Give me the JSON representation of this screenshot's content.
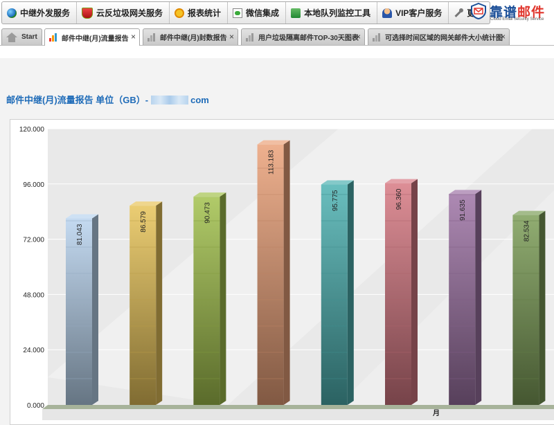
{
  "menu": [
    {
      "label": "中继外发服务",
      "icon": "globe-icon"
    },
    {
      "label": "云反垃圾网关服务",
      "icon": "shield-icon"
    },
    {
      "label": "报表统计",
      "icon": "report-icon"
    },
    {
      "label": "微信集成",
      "icon": "wechat-icon"
    },
    {
      "label": "本地队列监控工具",
      "icon": "queue-icon"
    },
    {
      "label": "VIP客户服务",
      "icon": "vip-user-icon"
    },
    {
      "label": "更多",
      "icon": "wrench-icon"
    }
  ],
  "brand": {
    "name": "靠谱",
    "name_accent": "邮件",
    "tagline": "Cloud Email Security Service"
  },
  "tabs": [
    {
      "label": "Start",
      "icon": "home-icon",
      "active": false,
      "closable": false
    },
    {
      "label": "邮件中继(月)流量报告",
      "icon": "bar-chart-icon",
      "active": true,
      "closable": true
    },
    {
      "label": "邮件中继(月)封数报告",
      "icon": "bar-chart-icon",
      "active": false,
      "closable": true
    },
    {
      "label": "用户垃圾隔离邮件TOP-30天图表",
      "icon": "bar-chart-icon",
      "active": false,
      "closable": true
    },
    {
      "label": "可选择时间区域的网关邮件大小统计图",
      "icon": "bar-chart-icon",
      "active": false,
      "closable": true
    }
  ],
  "close_glyph": "×",
  "report": {
    "title": "邮件中继(月)流量报告 单位（GB）-",
    "domain_suffix": "com"
  },
  "chart_data": {
    "type": "bar",
    "style": "3d-columns",
    "categories": [
      "",
      "",
      "",
      "",
      "",
      "",
      "",
      ""
    ],
    "values": [
      81.043,
      86.579,
      90.473,
      113.183,
      95.775,
      96.36,
      91.635,
      82.534
    ],
    "value_labels": [
      "81.043",
      "86.579",
      "90.473",
      "113.183",
      "95.775",
      "96.360",
      "91.635",
      "82.534"
    ],
    "colors": [
      "#b9d4ef",
      "#e8c45a",
      "#a3c24e",
      "#eba27a",
      "#4fb2b2",
      "#d77a84",
      "#9f74a6",
      "#7d9f59"
    ],
    "y_ticks": [
      "0.000",
      "24.000",
      "48.000",
      "72.000",
      "96.000",
      "120.000"
    ],
    "ylim": [
      0,
      120
    ],
    "xlabel": "月",
    "grid": true
  }
}
